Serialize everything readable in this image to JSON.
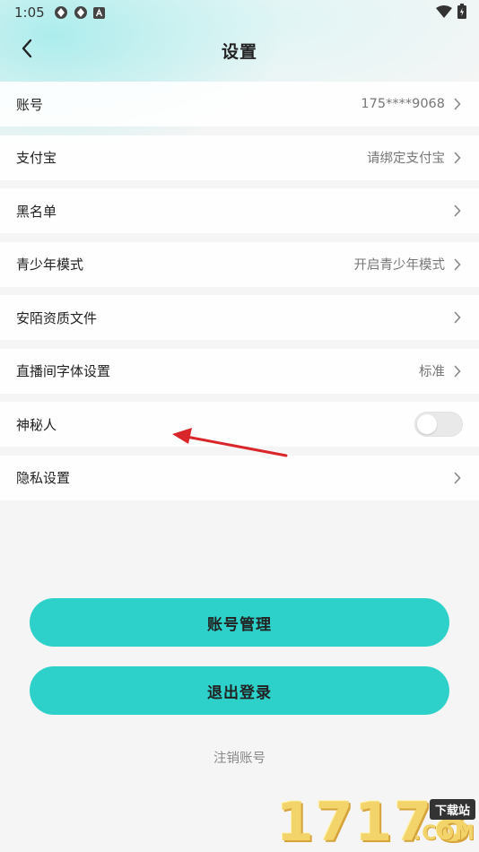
{
  "status_bar": {
    "time": "1:05",
    "left_icons": [
      "gear-shield-icon",
      "gear-shield-icon",
      "a-box-icon"
    ],
    "right_icons": [
      "wifi-icon",
      "battery-icon"
    ]
  },
  "nav": {
    "back_icon": "chevron-left-icon",
    "title": "设置"
  },
  "settings": {
    "items": [
      {
        "label": "账号",
        "value": "175****9068",
        "control": "chevron"
      },
      {
        "label": "支付宝",
        "value": "请绑定支付宝",
        "control": "chevron"
      },
      {
        "label": "黑名单",
        "value": "",
        "control": "chevron"
      },
      {
        "label": "青少年模式",
        "value": "开启青少年模式",
        "control": "chevron"
      },
      {
        "label": "安陌资质文件",
        "value": "",
        "control": "chevron"
      },
      {
        "label": "直播间字体设置",
        "value": "标准",
        "control": "chevron"
      },
      {
        "label": "神秘人",
        "value": "",
        "control": "toggle",
        "toggle_on": false
      },
      {
        "label": "隐私设置",
        "value": "",
        "control": "chevron"
      }
    ]
  },
  "buttons": {
    "account_manage": "账号管理",
    "logout": "退出登录",
    "cancel_account": "注销账号"
  },
  "watermark": {
    "digits": "17178",
    "top_label": "下载站",
    "bottom_label": ".COM"
  },
  "colors": {
    "accent": "#2dd1c9",
    "annotation_arrow": "#d9262b",
    "background": "#f5f5f5"
  }
}
